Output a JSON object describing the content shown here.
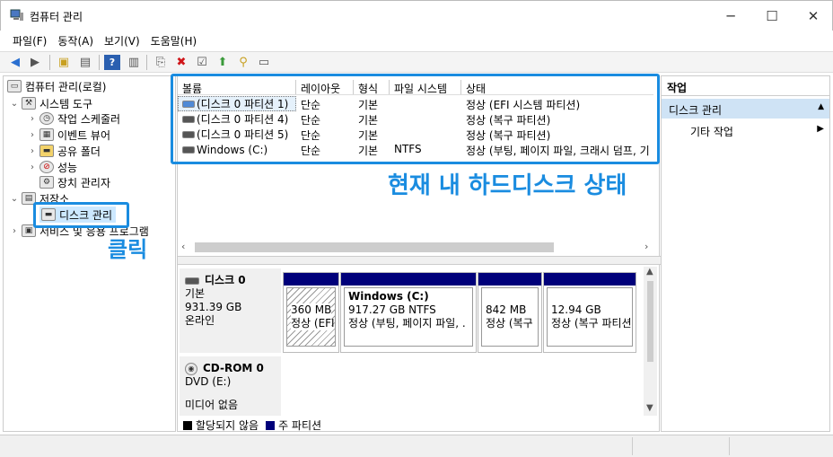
{
  "window": {
    "title": "컴퓨터 관리"
  },
  "menubar": {
    "items": [
      "파일(F)",
      "동작(A)",
      "보기(V)",
      "도움말(H)"
    ]
  },
  "tree": {
    "root": "컴퓨터 관리(로컬)",
    "system_tools": "시스템 도구",
    "task_scheduler": "작업 스케줄러",
    "event_viewer": "이벤트 뷰어",
    "shared_folders": "공유 폴더",
    "performance": "성능",
    "device_manager": "장치 관리자",
    "storage": "저장소",
    "disk_management": "디스크 관리",
    "services": "서비스 및 응용 프로그램"
  },
  "volume_table": {
    "headers": [
      "볼륨",
      "레이아웃",
      "형식",
      "파일 시스템",
      "상태"
    ],
    "rows": [
      [
        "(디스크 0 파티션 1)",
        "단순",
        "기본",
        "",
        "정상 (EFI 시스템 파티션)"
      ],
      [
        "(디스크 0 파티션 4)",
        "단순",
        "기본",
        "",
        "정상 (복구 파티션)"
      ],
      [
        "(디스크 0 파티션 5)",
        "단순",
        "기본",
        "",
        "정상 (복구 파티션)"
      ],
      [
        "Windows (C:)",
        "단순",
        "기본",
        "NTFS",
        "정상 (부팅, 페이지 파일, 크래시 덤프, 기"
      ]
    ]
  },
  "disks": [
    {
      "name": "디스크 0",
      "type": "기본",
      "size": "931.39 GB",
      "status": "온라인"
    },
    {
      "name": "CD-ROM 0",
      "type": "DVD (E:)",
      "size": "",
      "status": "미디어 없음"
    }
  ],
  "partitions": [
    {
      "title": "",
      "size": "360 MB",
      "status": "정상 (EFI"
    },
    {
      "title": "Windows  (C:)",
      "size": "917.27 GB NTFS",
      "status": "정상 (부팅, 페이지 파일, ."
    },
    {
      "title": "",
      "size": "842 MB",
      "status": "정상 (복구"
    },
    {
      "title": "",
      "size": "12.94 GB",
      "status": "정상 (복구 파티션"
    }
  ],
  "legend": {
    "unallocated": "할당되지 않음",
    "primary": "주 파티션"
  },
  "actions": {
    "header": "작업",
    "section": "디스크 관리",
    "more": "기타 작업"
  },
  "annotations": {
    "disk_status": "현재 내 하드디스크 상태",
    "click": "클릭"
  },
  "colors": {
    "accent": "#1a8ce0",
    "primary_partition": "#00007a",
    "selection": "#cce8ff"
  }
}
